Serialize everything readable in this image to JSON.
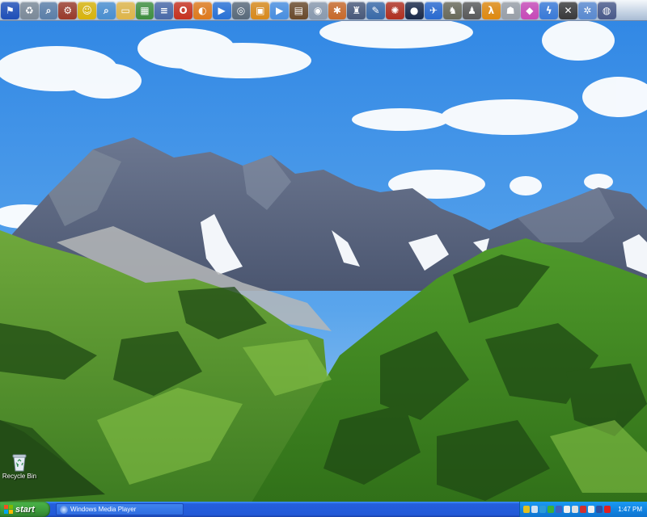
{
  "dock": {
    "icons": [
      {
        "name": "windows-flag-icon",
        "glyph": "⚑",
        "color": "#1f4fb8"
      },
      {
        "name": "recycle-bin-icon",
        "glyph": "♻",
        "color": "#7c8a98"
      },
      {
        "name": "search-magnifier-icon",
        "glyph": "⌕",
        "color": "#5b7fa8"
      },
      {
        "name": "network-icon",
        "glyph": "⚙",
        "color": "#9a3a2a"
      },
      {
        "name": "smiley-icon",
        "glyph": "☺",
        "color": "#d9b40b"
      },
      {
        "name": "magnifier-icon",
        "glyph": "⌕",
        "color": "#4a8fd0"
      },
      {
        "name": "folder-icon",
        "glyph": "▭",
        "color": "#e0b64a"
      },
      {
        "name": "spreadsheet-icon",
        "glyph": "▦",
        "color": "#3f8f3f"
      },
      {
        "name": "document-icon",
        "glyph": "≡",
        "color": "#4a6aa8"
      },
      {
        "name": "opera-browser-icon",
        "glyph": "O",
        "color": "#c8321f"
      },
      {
        "name": "firefox-browser-icon",
        "glyph": "◐",
        "color": "#e07a1b"
      },
      {
        "name": "media-play-icon",
        "glyph": "▶",
        "color": "#2a72d6"
      },
      {
        "name": "steam-icon",
        "glyph": "◎",
        "color": "#5a6a7a"
      },
      {
        "name": "tv-icon",
        "glyph": "▣",
        "color": "#d98a1b"
      },
      {
        "name": "quicktime-icon",
        "glyph": "▶",
        "color": "#4a8fe0"
      },
      {
        "name": "film-strip-icon",
        "glyph": "▤",
        "color": "#6a4a2a"
      },
      {
        "name": "disc-icon",
        "glyph": "◉",
        "color": "#8a9aae"
      },
      {
        "name": "network-hub-icon",
        "glyph": "✱",
        "color": "#c86a2a"
      },
      {
        "name": "robot-figure-icon",
        "glyph": "♜",
        "color": "#4a5a7a"
      },
      {
        "name": "tools-icon",
        "glyph": "✎",
        "color": "#3a6aa8"
      },
      {
        "name": "rebel-alliance-icon",
        "glyph": "✺",
        "color": "#b03020"
      },
      {
        "name": "logo-badge-icon",
        "glyph": "●",
        "color": "#1a2a4a"
      },
      {
        "name": "airplane-icon",
        "glyph": "✈",
        "color": "#2a6ad0"
      },
      {
        "name": "soldier-figure-icon",
        "glyph": "♞",
        "color": "#6a6a5a"
      },
      {
        "name": "mech-figure-icon",
        "glyph": "♟",
        "color": "#5a5a5a"
      },
      {
        "name": "half-life-icon",
        "glyph": "λ",
        "color": "#e08a10"
      },
      {
        "name": "stormtrooper-icon",
        "glyph": "☗",
        "color": "#9aa0a8"
      },
      {
        "name": "color-palette-icon",
        "glyph": "◆",
        "color": "#c84ab8"
      },
      {
        "name": "lightning-icon",
        "glyph": "ϟ",
        "color": "#3a7ad8"
      },
      {
        "name": "close-x-icon",
        "glyph": "✕",
        "color": "#3a3a3a"
      },
      {
        "name": "settings-gear-icon",
        "glyph": "✲",
        "color": "#5a8ad0"
      },
      {
        "name": "globe-icon",
        "glyph": "◍",
        "color": "#4a5a8a"
      }
    ]
  },
  "desktop": {
    "recycle_bin_label": "Recycle Bin"
  },
  "taskbar": {
    "start_label": "start",
    "task_wmp_label": "Windows Media Player",
    "clock": "1:47 PM",
    "tray_icons": [
      {
        "name": "shield-tray-icon",
        "color": "#e0c020"
      },
      {
        "name": "network-tray-icon",
        "color": "#d0e0f0"
      },
      {
        "name": "antivirus-tray-icon",
        "color": "#2a9ad8"
      },
      {
        "name": "messenger-tray-icon",
        "color": "#3ab03a"
      },
      {
        "name": "security-tray-icon",
        "color": "#4060c0"
      },
      {
        "name": "update-tray-icon",
        "color": "#f0f0f0"
      },
      {
        "name": "volume-tray-icon",
        "color": "#e0e0e0"
      },
      {
        "name": "flag-tray-icon",
        "color": "#d03030"
      },
      {
        "name": "chat-tray-icon",
        "color": "#f0f0f0"
      },
      {
        "name": "monitor-tray-icon",
        "color": "#3050a0"
      },
      {
        "name": "alert-tray-icon",
        "color": "#e02020"
      }
    ]
  }
}
